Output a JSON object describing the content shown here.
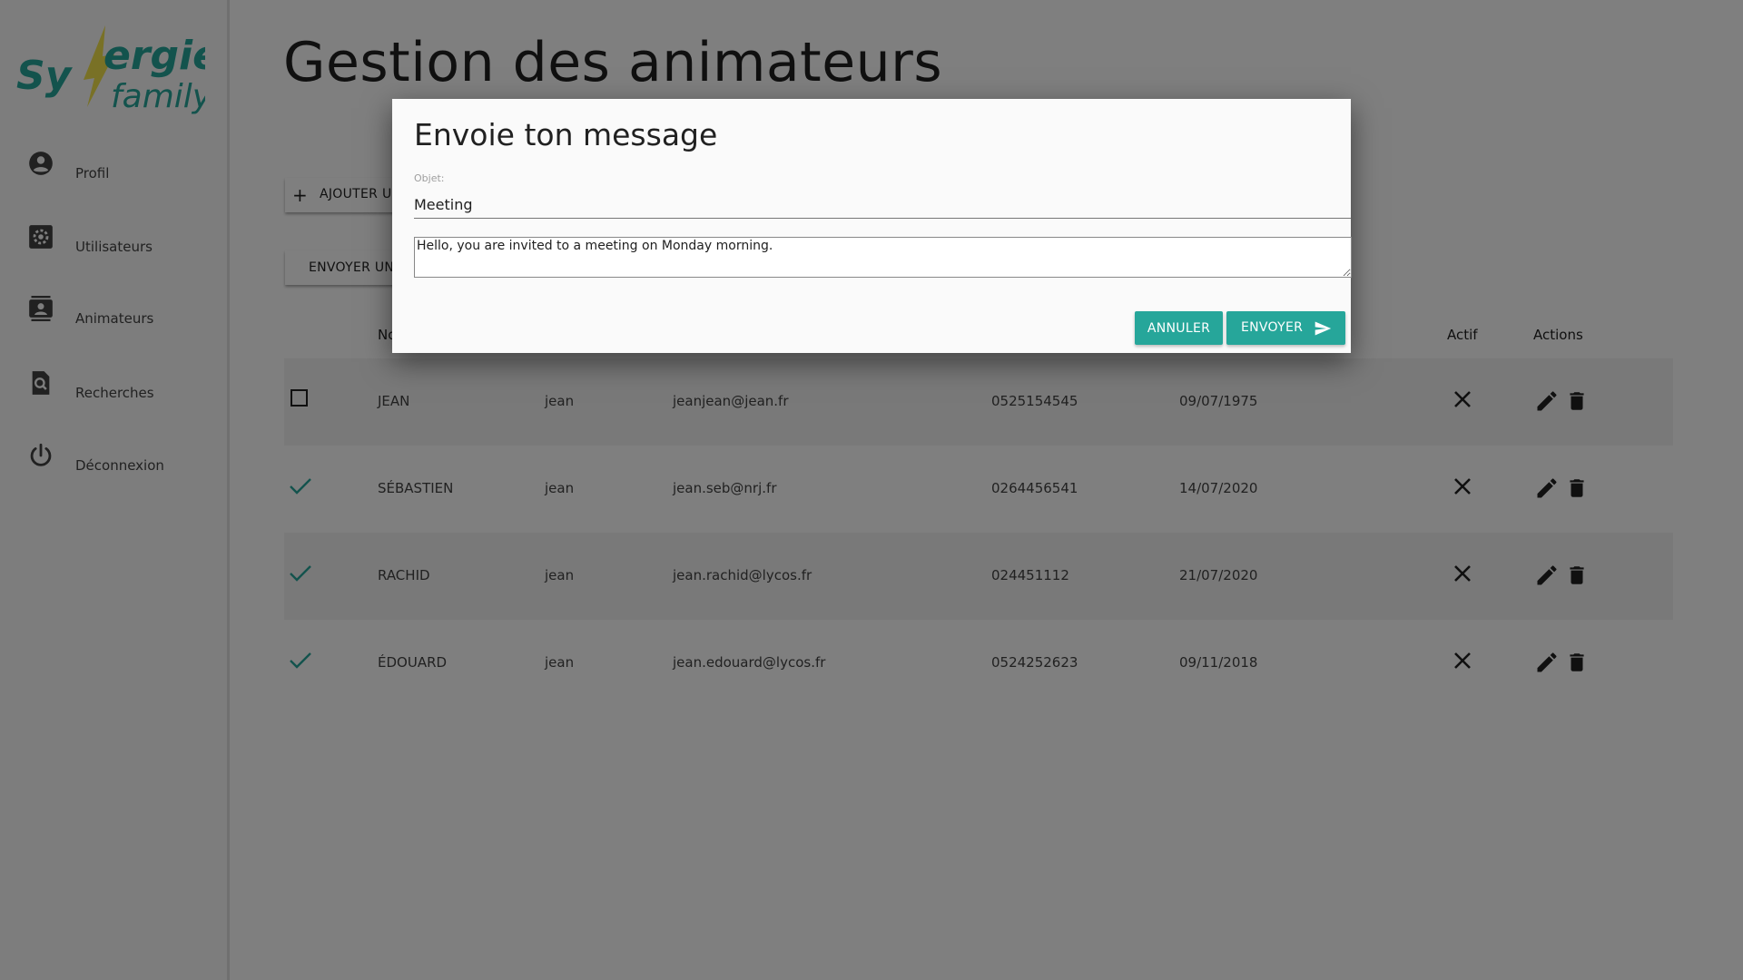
{
  "sidebar": {
    "logo": {
      "word1_left": "Sy",
      "word1_right": "ergie",
      "word2": "family"
    },
    "items": [
      {
        "label": "Profil",
        "icon": "account-circle-icon"
      },
      {
        "label": "Utilisateurs",
        "icon": "user-settings-icon"
      },
      {
        "label": "Animateurs",
        "icon": "contacts-icon"
      },
      {
        "label": "Recherches",
        "icon": "search-doc-icon"
      },
      {
        "label": "Déconnexion",
        "icon": "power-icon"
      }
    ]
  },
  "main": {
    "title": "Gestion des animateurs",
    "add_button": {
      "label": "AJOUTER UN"
    },
    "send_button": {
      "label": "ENVOYER UN"
    },
    "table": {
      "headers": {
        "nom": "No",
        "actif": "Actif",
        "actions": "Actions"
      },
      "rows": [
        {
          "selected": false,
          "nom": "JEAN",
          "prenom": "jean",
          "email": "jeanjean@jean.fr",
          "tel": "0525154545",
          "date": "09/07/1975"
        },
        {
          "selected": true,
          "nom": "SÉBASTIEN",
          "prenom": "jean",
          "email": "jean.seb@nrj.fr",
          "tel": "0264456541",
          "date": "14/07/2020"
        },
        {
          "selected": true,
          "nom": "RACHID",
          "prenom": "jean",
          "email": "jean.rachid@lycos.fr",
          "tel": "024451112",
          "date": "21/07/2020"
        },
        {
          "selected": true,
          "nom": "ÉDOUARD",
          "prenom": "jean",
          "email": "jean.edouard@lycos.fr",
          "tel": "0524252623",
          "date": "09/11/2018"
        }
      ]
    }
  },
  "dialog": {
    "title": "Envoie ton message",
    "subject_label": "Objet:",
    "subject_value": "Meeting",
    "message_value": "Hello, you are invited to a meeting on Monday morning.",
    "cancel_label": "ANNULER",
    "send_label": "ENVOYER"
  },
  "colors": {
    "accent": "#26a69a",
    "logo_teal": "#26a69a",
    "logo_yellow": "#f2e34c",
    "overlay": "rgba(0,0,0,0.5)"
  }
}
